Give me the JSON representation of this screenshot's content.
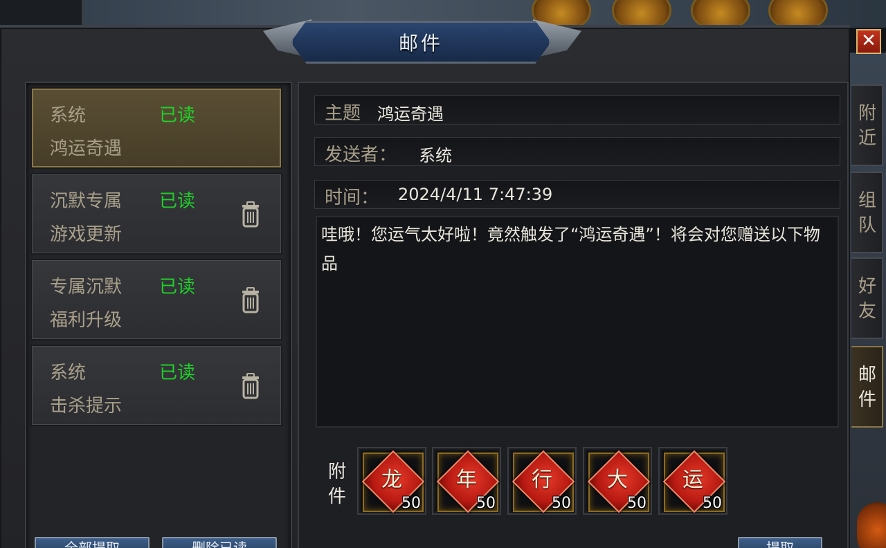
{
  "window": {
    "title": "邮件",
    "close_label": "✕"
  },
  "mail_list": [
    {
      "sender": "系统",
      "status": "已读",
      "subject": "鸿运奇遇",
      "selected": true,
      "has_trash": false
    },
    {
      "sender": "沉默专属",
      "status": "已读",
      "subject": "游戏更新",
      "selected": false,
      "has_trash": true
    },
    {
      "sender": "专属沉默",
      "status": "已读",
      "subject": "福利升级",
      "selected": false,
      "has_trash": true
    },
    {
      "sender": "系统",
      "status": "已读",
      "subject": "击杀提示",
      "selected": false,
      "has_trash": true
    }
  ],
  "bottom_buttons": {
    "collect_all": "全部提取",
    "delete_read": "删除已读",
    "collect": "提取"
  },
  "detail": {
    "subject_label": "主题",
    "subject_value": "鸿运奇遇",
    "sender_label": "发送者：",
    "sender_value": "系统",
    "time_label": "时间：",
    "time_value": "2024/4/11 7:47:39",
    "body": "哇哦！您运气太好啦！竟然触发了“鸿运奇遇”！将会对您赠送以下物品"
  },
  "attachments": {
    "label": "附件",
    "items": [
      {
        "glyph": "龙",
        "qty": "50"
      },
      {
        "glyph": "年",
        "qty": "50"
      },
      {
        "glyph": "行",
        "qty": "50"
      },
      {
        "glyph": "大",
        "qty": "50"
      },
      {
        "glyph": "运",
        "qty": "50"
      }
    ]
  },
  "side_tabs": [
    {
      "label": "附近",
      "active": false
    },
    {
      "label": "组队",
      "active": false
    },
    {
      "label": "好友",
      "active": false
    },
    {
      "label": "邮件",
      "active": true
    }
  ],
  "colors": {
    "read_status": "#20d02a",
    "label_text": "#a9a08a",
    "title_banner": "#20365a",
    "attachment_diamond": "#b81a12"
  }
}
